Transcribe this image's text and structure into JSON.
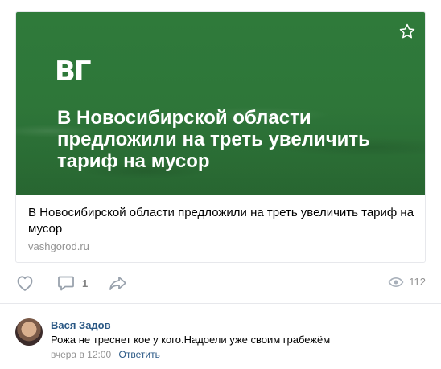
{
  "link_card": {
    "logo": "ВГ",
    "overlay_title": "В Новосибирской области предложили на треть увеличить тариф на мусор",
    "title": "В Новосибирской области предложили на треть увеличить тариф на мусор",
    "domain": "vashgorod.ru",
    "bookmark_icon": "star-icon",
    "image_color": "#2e7639"
  },
  "actions": {
    "like_icon": "heart-icon",
    "comment_icon": "comment-icon",
    "comment_count": "1",
    "share_icon": "share-icon",
    "views_icon": "eye-icon",
    "views_count": "112"
  },
  "comment": {
    "author": "Вася Задов",
    "text": "Рожа не треснет кое у кого.Надоели уже своим грабежём",
    "time": "вчера в 12:00",
    "reply_label": "Ответить",
    "link_color": "#2a5885"
  }
}
